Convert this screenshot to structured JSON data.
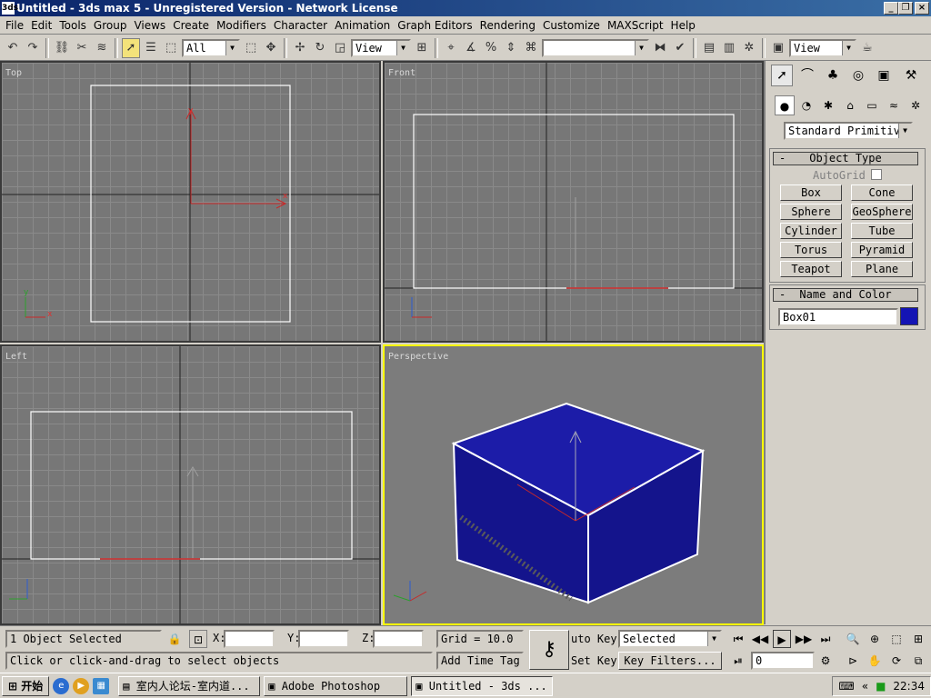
{
  "window": {
    "title": "Untitled - 3ds max 5 - Unregistered Version - Network License",
    "app_icon": "3ds"
  },
  "menu": [
    "File",
    "Edit",
    "Tools",
    "Group",
    "Views",
    "Create",
    "Modifiers",
    "Character",
    "Animation",
    "Graph Editors",
    "Rendering",
    "Customize",
    "MAXScript",
    "Help"
  ],
  "toolbar": {
    "selection_filter": "All",
    "ref_coord": "View",
    "named_sel": "",
    "render_view": "View"
  },
  "viewports": {
    "top": {
      "label": "Top"
    },
    "front": {
      "label": "Front"
    },
    "left": {
      "label": "Left"
    },
    "perspective": {
      "label": "Perspective"
    }
  },
  "axis": {
    "x": "x",
    "y": "y",
    "z": "z"
  },
  "colors": {
    "box": "#14148c",
    "box_top": "#1c1ca8",
    "active_border": "#ffff00",
    "swatch": "#1414b4"
  },
  "command_panel": {
    "category_dropdown": "Standard Primitiv",
    "object_type": {
      "header": "Object Type",
      "autogrid": "AutoGrid",
      "buttons": [
        "Box",
        "Cone",
        "Sphere",
        "GeoSphere",
        "Cylinder",
        "Tube",
        "Torus",
        "Pyramid",
        "Teapot",
        "Plane"
      ]
    },
    "name_color": {
      "header": "Name and Color",
      "name_value": "Box01"
    }
  },
  "status": {
    "selected": "1 Object Selected",
    "prompt": "Click or click-and-drag to select objects",
    "x_label": "X:",
    "y_label": "Y:",
    "z_label": "Z:",
    "grid": "Grid = 10.0",
    "add_time_tag": "Add Time Tag",
    "auto_key": "uto Key",
    "set_key": "Set Key",
    "key_mode": "Selected",
    "key_filters": "Key Filters...",
    "frame": "0"
  },
  "taskbar": {
    "start": "开始",
    "tasks": [
      "室内人论坛-室内道...",
      "Adobe Photoshop",
      "Untitled - 3ds ..."
    ],
    "clock": "22:34"
  }
}
